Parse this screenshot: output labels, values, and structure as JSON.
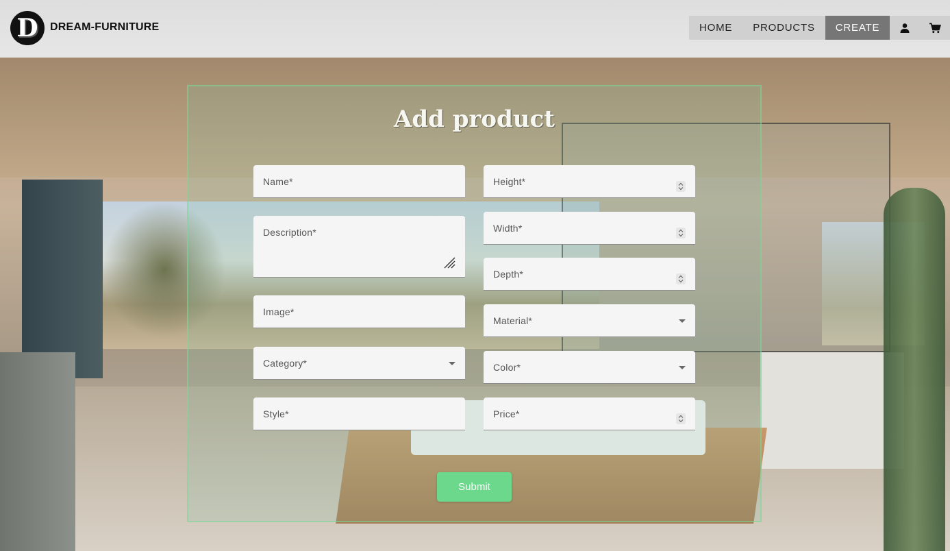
{
  "brand": {
    "logo_letter": "D",
    "name": "DREAM-FURNITURE"
  },
  "nav": {
    "items": [
      {
        "label": "HOME",
        "active": false
      },
      {
        "label": "PRODUCTS",
        "active": false
      },
      {
        "label": "CREATE",
        "active": true
      }
    ],
    "icons": [
      "user-icon",
      "cart-icon"
    ]
  },
  "form": {
    "title": "Add product",
    "left_fields": [
      {
        "label": "Name*",
        "type": "text"
      },
      {
        "label": "Description*",
        "type": "textarea"
      },
      {
        "label": "Image*",
        "type": "text"
      },
      {
        "label": "Category*",
        "type": "select"
      },
      {
        "label": "Style*",
        "type": "text"
      }
    ],
    "right_fields": [
      {
        "label": "Height*",
        "type": "number"
      },
      {
        "label": "Width*",
        "type": "number"
      },
      {
        "label": "Depth*",
        "type": "number"
      },
      {
        "label": "Material*",
        "type": "select"
      },
      {
        "label": "Color*",
        "type": "select"
      },
      {
        "label": "Price*",
        "type": "number"
      }
    ],
    "submit_label": "Submit"
  },
  "colors": {
    "header_bg": "#e0e0e0",
    "nav_active_bg": "#767676",
    "submit_bg": "#6bd88b",
    "field_bg": "#f5f5f5",
    "panel_border": "#78dc96"
  }
}
